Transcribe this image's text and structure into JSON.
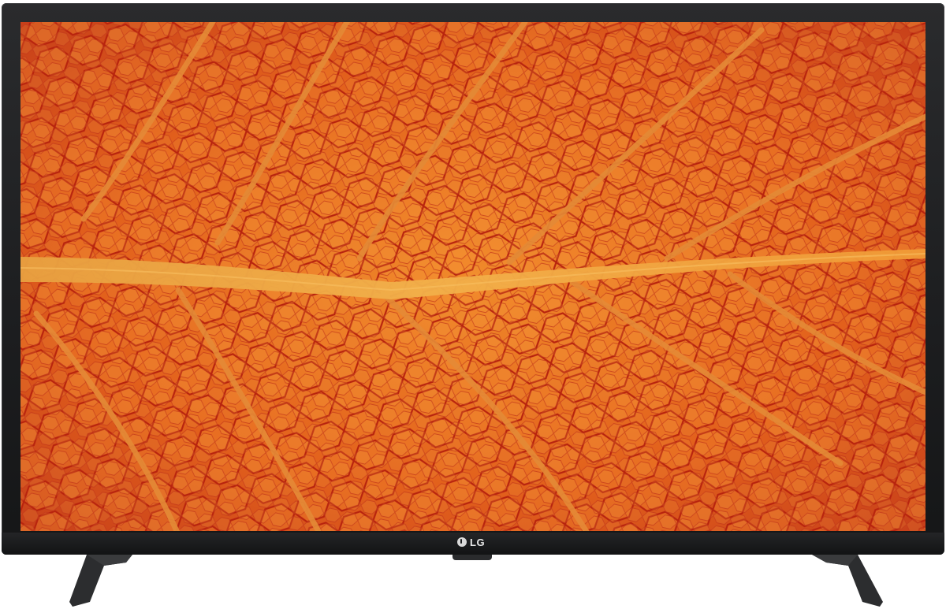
{
  "product": {
    "brand_logo_text": "LG",
    "screen_image": "orange-leaf-macro-wallpaper",
    "colors": {
      "bezel": "#1c1d1f",
      "leaf_base": "#e0581a",
      "leaf_highlight": "#f2a23a",
      "vein_dark": "#c02a10",
      "midrib": "#f0a83c"
    }
  }
}
